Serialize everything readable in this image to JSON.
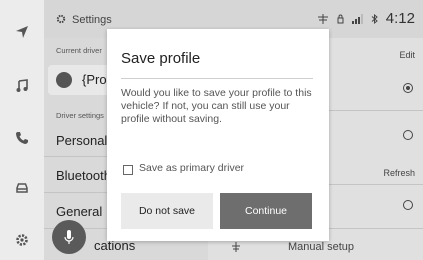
{
  "status_bar": {
    "time": "4:12"
  },
  "settings": {
    "title": "Settings",
    "current_driver_label": "Current driver",
    "driver_name": "{Pro",
    "driver_settings_label": "Driver settings",
    "items": [
      {
        "label": "Personal"
      },
      {
        "label": "Bluetooth"
      },
      {
        "label": "General"
      },
      {
        "label": "cations"
      }
    ],
    "right": {
      "edit_label": "Edit",
      "refresh_label": "Refresh",
      "manual_setup_label": "Manual setup"
    }
  },
  "dialog": {
    "title": "Save profile",
    "message": "Would you like to save your profile to this vehicle? If not, you can still use your profile without saving.",
    "checkbox_label": "Save as primary driver",
    "checkbox_checked": false,
    "do_not_save_label": "Do not save",
    "continue_label": "Continue"
  },
  "colors": {
    "primary_button": "#6e6e6e",
    "secondary_button": "#eaeaea"
  }
}
